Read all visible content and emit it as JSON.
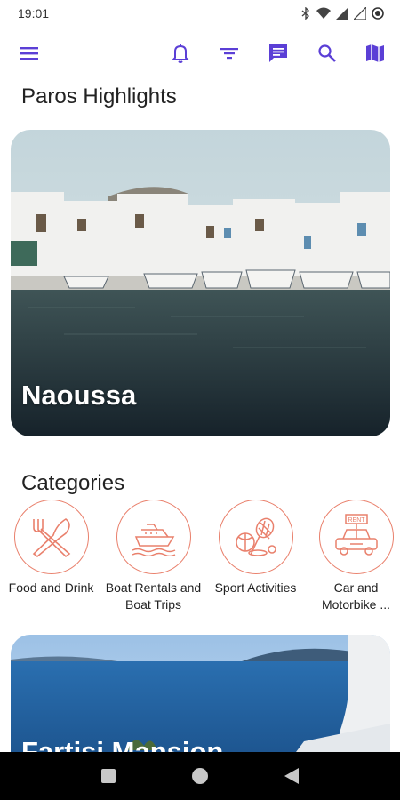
{
  "status": {
    "time": "19:01"
  },
  "toolbar": {
    "icons": [
      "menu-icon",
      "bell-icon",
      "filter-icon",
      "chat-icon",
      "search-icon",
      "map-icon"
    ],
    "accent": "#5b3fd6"
  },
  "highlights": {
    "title": "Paros Highlights",
    "card_title": "Naoussa"
  },
  "categories": {
    "title": "Categories",
    "accent": "#e9806c",
    "items": [
      {
        "label": "Food and Drink",
        "icon": "fork-knife-icon"
      },
      {
        "label": "Boat Rentals and Boat Trips",
        "icon": "boat-icon"
      },
      {
        "label": "Sport Activities",
        "icon": "sports-icon"
      },
      {
        "label": "Car and Motorbike ...",
        "icon": "rent-car-icon"
      }
    ]
  },
  "second_card": {
    "title": "Fartisi Mansion"
  }
}
